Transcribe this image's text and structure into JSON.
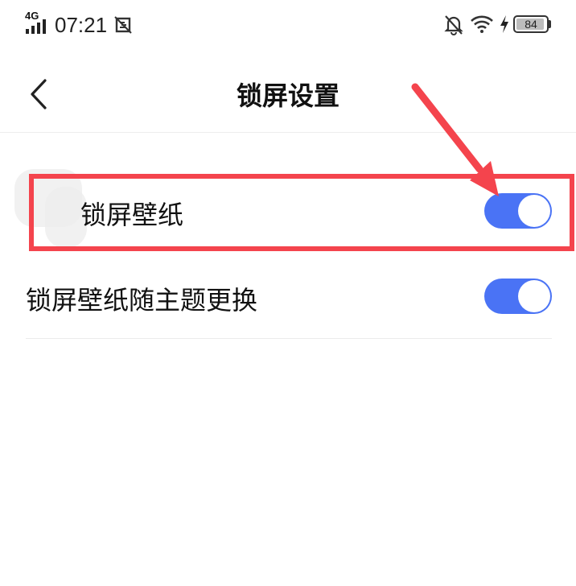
{
  "status_bar": {
    "network": "4G",
    "time": "07:21",
    "battery": "84"
  },
  "header": {
    "title": "锁屏设置"
  },
  "settings": [
    {
      "label": "锁屏壁纸",
      "enabled": true
    },
    {
      "label": "锁屏壁纸随主题更换",
      "enabled": true
    }
  ],
  "colors": {
    "accent": "#4a73f5",
    "annotation": "#f4444d"
  },
  "icons": [
    "signal-icon",
    "screenshot-icon",
    "mute-bell-icon",
    "wifi-icon",
    "charging-icon",
    "battery-icon",
    "back-chevron-icon",
    "annotation-arrow"
  ]
}
